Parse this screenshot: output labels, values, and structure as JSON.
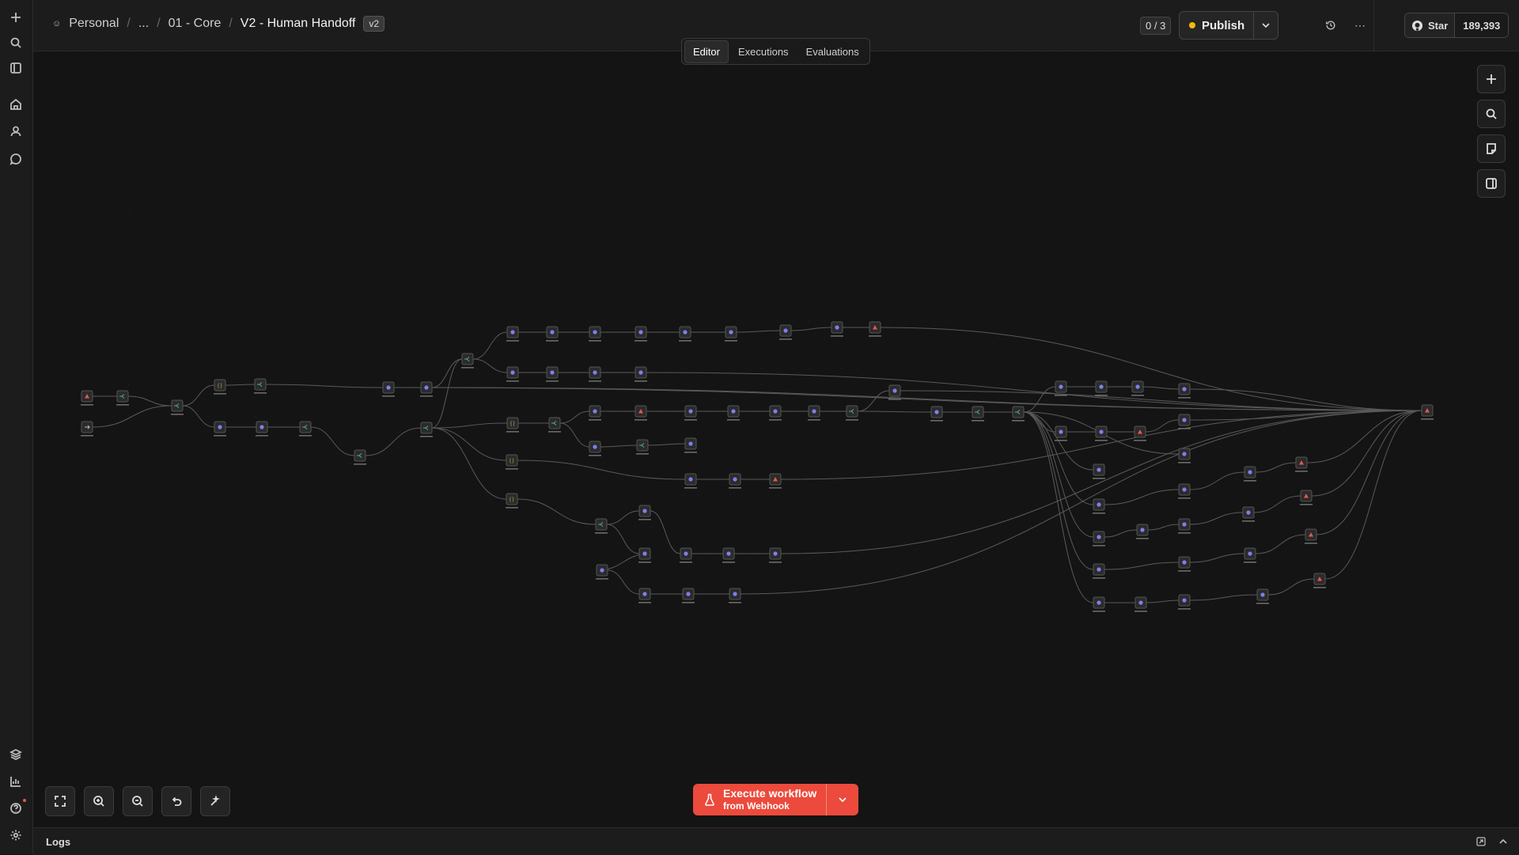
{
  "sidebar": {
    "top_icons": [
      "plus-icon",
      "search-icon",
      "panel-icon",
      "home-icon",
      "user-icon",
      "chat-icon"
    ],
    "bottom_icons": [
      "templates-icon",
      "insights-icon",
      "help-icon",
      "settings-icon"
    ]
  },
  "header": {
    "breadcrumb": {
      "project": "Personal",
      "ellipsis": "...",
      "folder": "01 - Core",
      "workflow": "V2 - Human Handoff",
      "version": "v2"
    },
    "counter": "0 / 3",
    "publish_label": "Publish",
    "github": {
      "star_label": "Star",
      "count": "189,393"
    }
  },
  "tabs": [
    {
      "label": "Editor",
      "active": true
    },
    {
      "label": "Executions",
      "active": false
    },
    {
      "label": "Evaluations",
      "active": false
    }
  ],
  "execute": {
    "title": "Execute workflow",
    "subtitle": "from Webhook"
  },
  "logs": {
    "label": "Logs"
  },
  "colors": {
    "accent": "#ec4a3c",
    "publish_dot": "#f5b90b",
    "node_glyph": "#7d7ff0",
    "if_node": "#4fb387"
  }
}
